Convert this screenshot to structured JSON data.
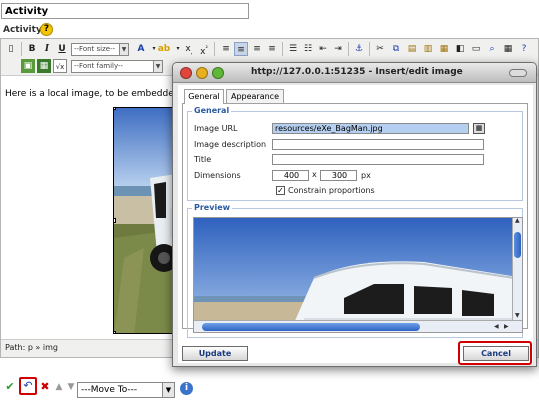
{
  "title_field": {
    "value": "Activity"
  },
  "activity_label": "Activity",
  "toolbar": {
    "font_size_label": "--Font size--",
    "font_family_label": "--Font family--"
  },
  "editor": {
    "content_text": "Here is a local image, to be embedded",
    "path_text": "Path: p » img"
  },
  "dialog": {
    "title": "http://127.0.0.1:51235 - Insert/edit image",
    "tabs": [
      {
        "label": "General",
        "active": true
      },
      {
        "label": "Appearance",
        "active": false
      }
    ],
    "general": {
      "legend": "General",
      "image_url_label": "Image URL",
      "image_url_value": "resources/eXe_BagMan.jpg",
      "image_description_label": "Image description",
      "image_description_value": "",
      "title_label": "Title",
      "title_value": "",
      "dimensions_label": "Dimensions",
      "width": "400",
      "times": "x",
      "height": "300",
      "unit": "px",
      "constrain_label": "Constrain proportions",
      "constrain_checked": true
    },
    "preview": {
      "legend": "Preview"
    },
    "update_label": "Update",
    "cancel_label": "Cancel"
  },
  "bottom": {
    "move_to_label": "---Move To---"
  },
  "colors": {
    "highlight": "#d00000",
    "legend_blue": "#2a5aa0",
    "button_text": "#1a3a80",
    "scroll_thumb": "#2e63c4"
  }
}
